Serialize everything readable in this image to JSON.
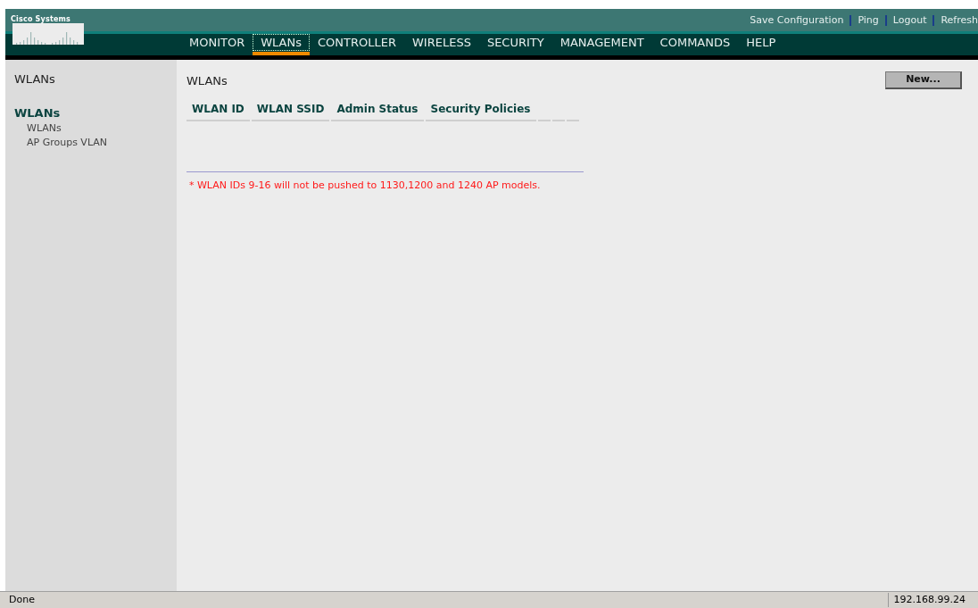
{
  "logo": {
    "text": "Cisco Systems"
  },
  "top_links": [
    "Save Configuration",
    "Ping",
    "Logout",
    "Refresh"
  ],
  "nav": [
    {
      "label": "MONITOR",
      "selected": false
    },
    {
      "label": "WLANs",
      "selected": true
    },
    {
      "label": "CONTROLLER",
      "selected": false
    },
    {
      "label": "WIRELESS",
      "selected": false
    },
    {
      "label": "SECURITY",
      "selected": false
    },
    {
      "label": "MANAGEMENT",
      "selected": false
    },
    {
      "label": "COMMANDS",
      "selected": false
    },
    {
      "label": "HELP",
      "selected": false
    }
  ],
  "sidebar": {
    "title": "WLANs",
    "section": "WLANs",
    "items": [
      "WLANs",
      "AP Groups VLAN"
    ]
  },
  "main": {
    "title": "WLANs",
    "new_button": "New...",
    "table": {
      "columns": [
        "WLAN ID",
        "WLAN SSID",
        "Admin Status",
        "Security Policies"
      ]
    },
    "note": "* WLAN IDs 9-16 will not be pushed to 1130,1200 and 1240 AP models."
  },
  "status_bar": {
    "text": "Done",
    "address": "192.168.99.24"
  }
}
